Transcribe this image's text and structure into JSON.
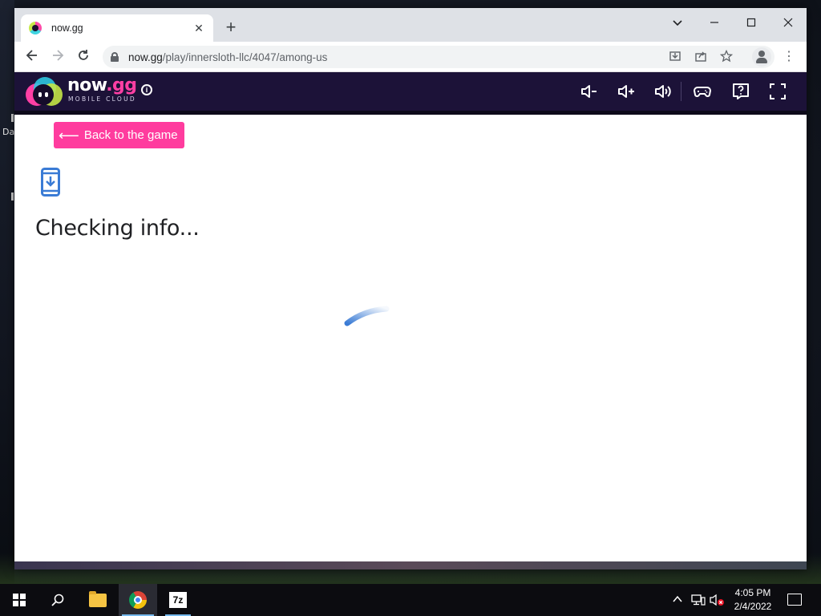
{
  "desktop": {
    "label_fragment": "Da"
  },
  "browser": {
    "tab": {
      "title": "now.gg",
      "favicon": "nowgg-favicon"
    },
    "new_tab_symbol": "+",
    "window_controls": {
      "dropdown": "⌵",
      "minimize": "—",
      "maximize": "☐",
      "close": "✕"
    },
    "nav": {
      "back": "←",
      "forward": "→",
      "reload": "↻"
    },
    "address": {
      "domain": "now.gg",
      "path": "/play/innersloth-llc/4047/among-us"
    },
    "omnibox_icons": [
      "install-icon",
      "share-icon",
      "star-icon"
    ]
  },
  "header": {
    "logo": {
      "word_now": "now",
      "word_gg": ".gg",
      "subtitle": "MOBILE CLOUD"
    },
    "info_symbol": "i",
    "controls": [
      "volume-down-icon",
      "volume-up-icon",
      "volume-mute-icon",
      "gamepad-icon",
      "help-icon",
      "fullscreen-icon"
    ]
  },
  "main": {
    "back_button": {
      "arrow": "⟵",
      "label": "Back to the game"
    },
    "status_title": "Checking info...",
    "icon": "phone-download-icon",
    "loading": "spinner"
  },
  "taskbar": {
    "apps": [
      "start-icon",
      "search-icon",
      "file-explorer-icon",
      "chrome-icon",
      "7zip-icon"
    ],
    "sevenzip_label": "7z",
    "clock": {
      "time": "4:05 PM",
      "date": "2/4/2022"
    },
    "accent_color": "#76b9ed"
  },
  "colors": {
    "brand_pink": "#ff3c9e",
    "header_bg": "#1c1238",
    "icon_blue": "#3a7bd5"
  }
}
